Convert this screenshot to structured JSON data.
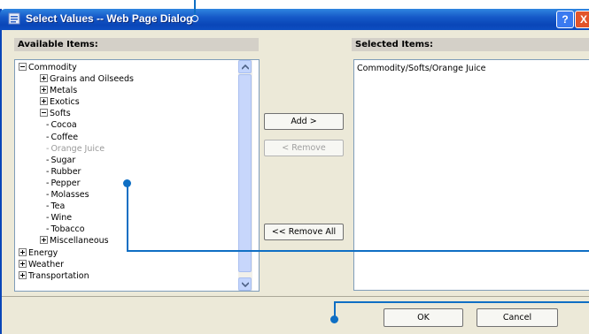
{
  "window": {
    "title": "Select Values -- Web Page Dialog",
    "help_label": "?",
    "close_label": "X"
  },
  "available": {
    "header": "Available Items:",
    "tree": [
      {
        "label": "Commodity",
        "indent": 0,
        "marker": "minus",
        "state": "normal"
      },
      {
        "label": "Grains and Oilseeds",
        "indent": 1,
        "marker": "plus",
        "state": "normal"
      },
      {
        "label": "Metals",
        "indent": 1,
        "marker": "plus",
        "state": "normal"
      },
      {
        "label": "Exotics",
        "indent": 1,
        "marker": "plus",
        "state": "normal"
      },
      {
        "label": "Softs",
        "indent": 1,
        "marker": "minus",
        "state": "normal"
      },
      {
        "label": "Cocoa",
        "indent": 2,
        "marker": "dash",
        "state": "normal"
      },
      {
        "label": "Coffee",
        "indent": 2,
        "marker": "dash",
        "state": "normal"
      },
      {
        "label": "Orange Juice",
        "indent": 2,
        "marker": "dash",
        "state": "disabled"
      },
      {
        "label": "Sugar",
        "indent": 2,
        "marker": "dash",
        "state": "normal"
      },
      {
        "label": "Rubber",
        "indent": 2,
        "marker": "dash",
        "state": "normal"
      },
      {
        "label": "Pepper",
        "indent": 2,
        "marker": "dash",
        "state": "normal"
      },
      {
        "label": "Molasses",
        "indent": 2,
        "marker": "dash",
        "state": "normal"
      },
      {
        "label": "Tea",
        "indent": 2,
        "marker": "dash",
        "state": "normal"
      },
      {
        "label": "Wine",
        "indent": 2,
        "marker": "dash",
        "state": "normal"
      },
      {
        "label": "Tobacco",
        "indent": 2,
        "marker": "dash",
        "state": "normal"
      },
      {
        "label": "Miscellaneous",
        "indent": 1,
        "marker": "plus",
        "state": "normal"
      },
      {
        "label": "Energy",
        "indent": 0,
        "marker": "plus",
        "state": "normal"
      },
      {
        "label": "Weather",
        "indent": 0,
        "marker": "plus",
        "state": "normal"
      },
      {
        "label": "Transportation",
        "indent": 0,
        "marker": "plus",
        "state": "normal"
      }
    ]
  },
  "buttons": {
    "add": "Add >",
    "remove": "< Remove",
    "remove_all": "<< Remove All",
    "ok": "OK",
    "cancel": "Cancel"
  },
  "selected": {
    "header": "Selected Items:",
    "items": [
      "Commodity/Softs/Orange Juice"
    ]
  },
  "colors": {
    "titlebar": "#0a46b8",
    "dialog_bg": "#ece9d8",
    "callout": "#0f6fc4",
    "disabled_text": "#999999"
  }
}
